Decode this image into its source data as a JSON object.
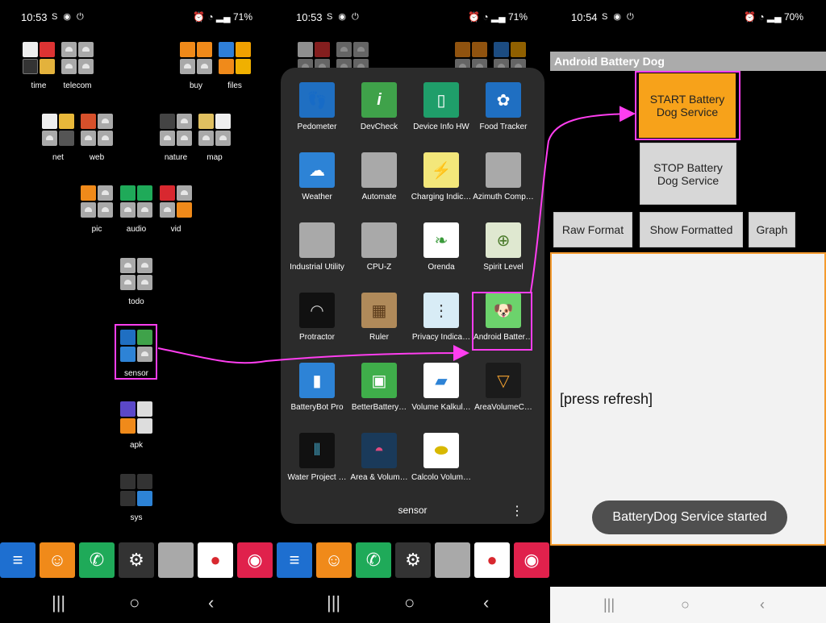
{
  "panel1": {
    "status": {
      "time": "10:53",
      "battery": "71%"
    },
    "folders": [
      {
        "name": "time"
      },
      {
        "name": "telecom"
      },
      {
        "name": "buy"
      },
      {
        "name": "files"
      },
      {
        "name": "net"
      },
      {
        "name": "web"
      },
      {
        "name": "nature"
      },
      {
        "name": "map"
      },
      {
        "name": "pic"
      },
      {
        "name": "audio"
      },
      {
        "name": "vid"
      },
      {
        "name": "todo"
      },
      {
        "name": "sensor"
      },
      {
        "name": "apk"
      },
      {
        "name": "sys"
      }
    ]
  },
  "panel2": {
    "status": {
      "time": "10:53",
      "battery": "71%"
    },
    "folder_title": "sensor",
    "menu_glyph": "⋮",
    "apps": [
      "Pedometer",
      "DevCheck",
      "Device Info HW",
      "Food Tracker",
      "Weather",
      "Automate",
      "Charging Indic…",
      "Azimuth Comp…",
      "Industrial Utility",
      "CPU-Z",
      "Orenda",
      "Spirit Level",
      "Protractor",
      "Ruler",
      "Privacy Indica…",
      "Android Batter…",
      "BatteryBot Pro",
      "BetterBattery…",
      "Volume Kalkul…",
      "AreaVolumeC…",
      "Water Project …",
      "Area & Volum…",
      "Calcolo Volum…"
    ]
  },
  "panel3": {
    "status": {
      "time": "10:54",
      "battery": "70%"
    },
    "app_title": "Android Battery Dog",
    "start_button": "START Battery Dog Service",
    "stop_button": "STOP Battery Dog Service",
    "raw_button": "Raw Format",
    "formatted_button": "Show Formatted",
    "graph_button": "Graph",
    "output_text": "[press refresh]",
    "toast": "BatteryDog Service started"
  },
  "nav": {
    "recent": "|||",
    "home": "○",
    "back": "‹"
  },
  "colors": {
    "highlight": "#ff3ef0",
    "start_button": "#f7a21a",
    "output_border": "#f49a2e"
  }
}
